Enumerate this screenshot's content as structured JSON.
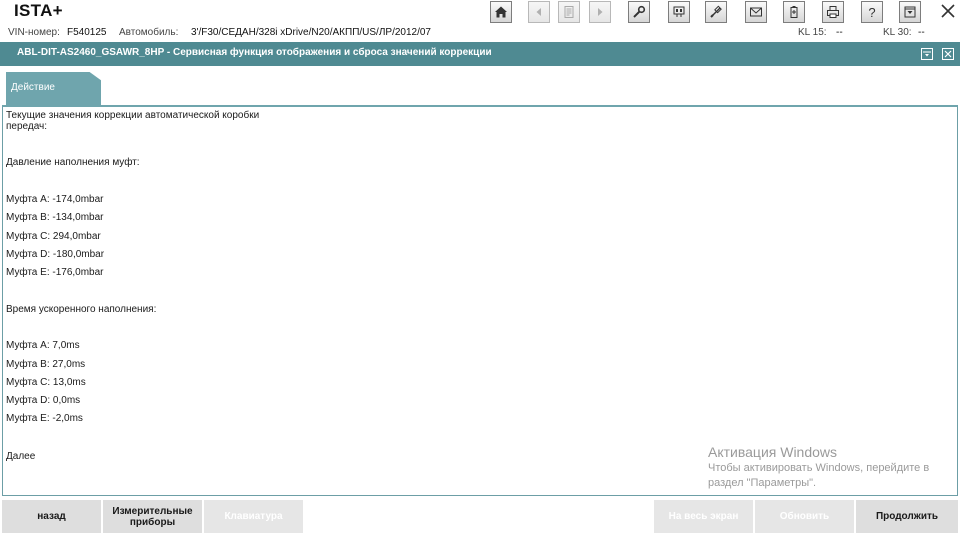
{
  "app": {
    "title": "ISTA+"
  },
  "toolbar": {
    "icons": [
      "home-icon",
      "back-icon",
      "document-icon",
      "forward-icon",
      "wrench-icon",
      "vehicle-diagnosis-icon",
      "plug-icon",
      "mail-icon",
      "battery-icon",
      "print-icon",
      "help-icon",
      "minimize-icon",
      "close-icon"
    ]
  },
  "info": {
    "vin_label": "VIN-номер:",
    "vin_value": "F540125",
    "car_label": "Автомобиль:",
    "car_value": "3'/F30/СЕДАН/328i xDrive/N20/АКПП/US/ЛР/2012/07",
    "kl15_label": "KL 15:",
    "kl15_value": "--",
    "kl30_label": "KL 30:",
    "kl30_value": "--"
  },
  "titlebar": {
    "title": "ABL-DIT-AS2460_GSAWR_8HP  -  Сервисная функция отображения и сброса значений коррекции"
  },
  "tab": {
    "label": "Действие"
  },
  "content": {
    "intro_line1": "Текущие значения коррекции автоматической коробки",
    "intro_line2": "передач:",
    "fill_pressure_heading": "Давление наполнения муфт:",
    "pressure": [
      "Муфта A: -174,0mbar",
      "Муфта B: -134,0mbar",
      "Муфта C: 294,0mbar",
      "Муфта D: -180,0mbar",
      "Муфта E: -176,0mbar"
    ],
    "fast_fill_heading": "Время ускоренного наполнения:",
    "fast_fill": [
      "Муфта A: 7,0ms",
      "Муфта B: 27,0ms",
      "Муфта C: 13,0ms",
      "Муфта D: 0,0ms",
      "Муфта E: -2,0ms"
    ],
    "next_label": "Далее"
  },
  "watermark": {
    "title": "Активация Windows",
    "line1": "Чтобы активировать Windows, перейдите в",
    "line2": "раздел \"Параметры\"."
  },
  "buttons": {
    "back": "назад",
    "instruments_line1": "Измерительные",
    "instruments_line2": "приборы",
    "keyboard": "Клавиатура",
    "fullscreen": "На весь экран",
    "refresh": "Обновить",
    "continue": "Продолжить"
  },
  "colors": {
    "accent": "#4f8a92",
    "tab": "#6fa5ad"
  }
}
